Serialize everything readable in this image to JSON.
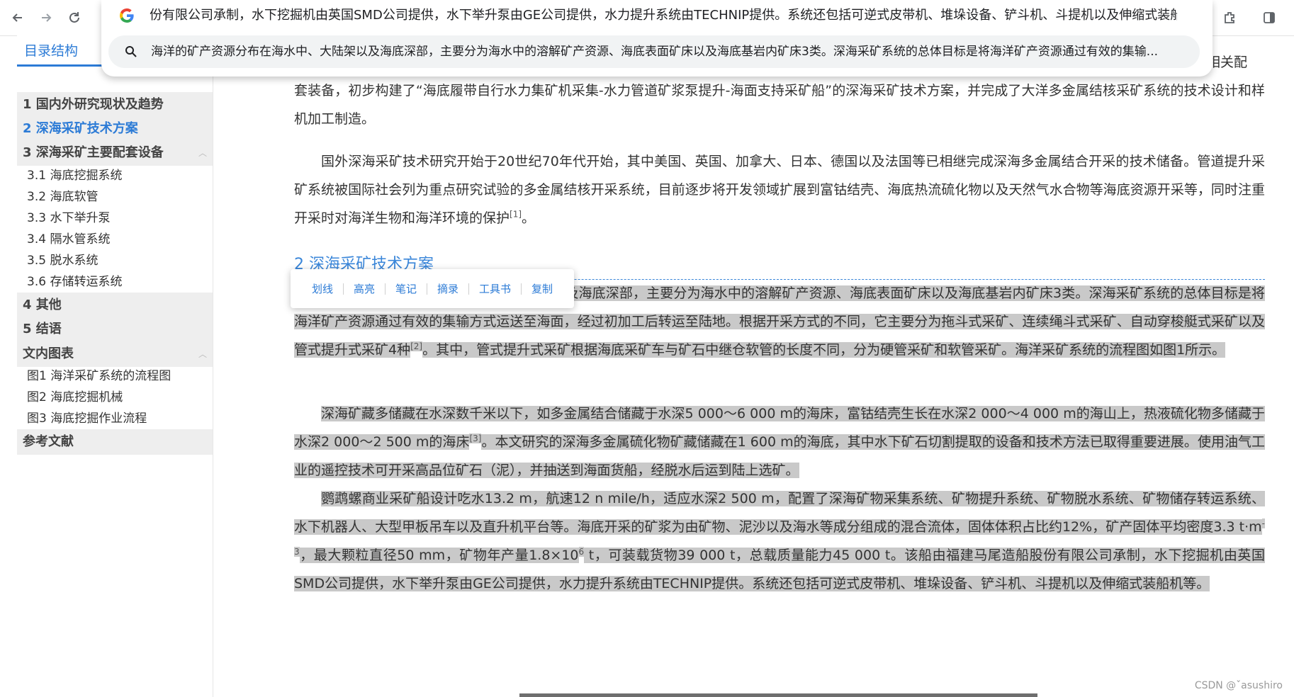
{
  "omnibox": {
    "text": "份有限公司承制，水下挖掘机由英国SMD公司提供，水下举升泵由GE公司提供，水力提升系统由TECHNIP提供。系统还包括可逆式皮带机、堆垛设备、铲斗机、斗提机以及伸缩式装船机等。",
    "suggestion": "海洋的矿产资源分布在海水中、大陆架以及海底深部，主要分为海水中的溶解矿产资源、海底表面矿床以及海底基岩内矿床3类。深海采矿系统的总体目标是将海洋矿产资源通过有效的集输..."
  },
  "sidebar": {
    "title": "目录结构",
    "sections": [
      {
        "label": "1 国内外研究现状及趋势"
      },
      {
        "label": "2 深海采矿技术方案"
      },
      {
        "label": "3 深海采矿主要配套设备"
      },
      {
        "label": "4 其他"
      },
      {
        "label": "5 结语"
      },
      {
        "label": "文内图表"
      },
      {
        "label": "参考文献"
      }
    ],
    "sub3": [
      "3.1 海底挖掘系统",
      "3.2 海底软管",
      "3.3 水下举升泵",
      "3.4 隔水管系统",
      "3.5 脱水系统",
      "3.6 存储转运系统"
    ],
    "figs": [
      "图1 海洋采矿系统的流程图",
      "图2 海底挖掘机械",
      "图3 海底挖掘作业流程"
    ]
  },
  "article": {
    "p0_tail": "X相关配",
    "p0": "套装备，初步构建了“海底履带自行水力集矿机采集-水力管道矿浆泵提升-海面支持采矿船”的深海采矿技术方案，并完成了大洋多金属结核采矿系统的技术设计和样机加工制造。",
    "p1": "国外深海采矿技术研究开始于20世纪70年代开始，其中美国、英国、加拿大、日本、德国以及法国等已相继完成深海多金属结合开采的技术储备。管道提升采矿系统被国际社会列为重点研究试验的多金属结核开采系统，目前逐步将开发领域扩展到富钴结壳、海底热流硫化物以及天然气水合物等海底资源开采等，同时注重开采时对海洋生物和海洋环境的保护",
    "p1_ref": "[1]",
    "p1_end": "。",
    "heading": "2 深海采矿技术方案",
    "p2a": "海洋的矿产资源分布在海水中、大陆架以及海底深部，主要分为海水中的溶解矿产资源、海底表面矿床以及海底基岩内矿床3类。深海采矿系统的总体目标是将海洋矿产资源通过有效的集输方式运送至海面，经过初加工后转运至陆地。根据开采方式的不同，它主要分为拖斗式采矿、连续绳斗式采矿、自动穿梭艇式采矿以及管式提升式采矿4种",
    "p2_ref": "[2]",
    "p2b": "。其中，管式提升式采矿根据海底采矿车与矿石中继仓软管的长度不同，分为硬管采矿和软管采矿。海洋采矿系统的流程图如图1所示。",
    "p3a": "深海矿藏多储藏在水深数千米以下，如多金属结合储藏于水深5 000～6 000 m的海床，富钴结壳生长在水深2 000～4 000 m的海山上，热液硫化物多储藏于水深2 000～2 500 m的海床",
    "p3_ref": "[3]",
    "p3b": "。本文研究的深海多金属硫化物矿藏储藏在1 600 m的海底，其中水下矿石切割提取的设备和技术方法已取得重要进展。使用油气工业的遥控技术可开采高品位矿石（泥），并抽送到海面货船，经脱水后运到陆上选矿。",
    "p4a": "鹦鹉螺商业采矿船设计吃水13.2 m，航速12 n mile/h，适应水深2 500 m，配置了深海矿物采集系统、矿物提升系统、矿物脱水系统、矿物储存转运系统、水下机器人、大型甲板吊车以及直升机平台等。海底开采的矿浆为由矿物、泥沙以及海水等成分组成的混合流体，固体体积占比约12%，矿产固体平均密度3.3 t·m",
    "p4_sup1": "-3",
    "p4b": "，最大颗粒直径50 mm，矿物年产量1.8×10",
    "p4_sup2": "6",
    "p4c": " t，可装载货物39 000 t，总载质量能力45 000 t。该船由福建马尾造船股份有限公司承制，水下挖掘机由英国SMD公司提供，水下举升泵由GE公司提供，水力提升系统由TECHNIP提供。系统还包括可逆式皮带机、堆垛设备、铲斗机、斗提机以及伸缩式装船机等。"
  },
  "popup": {
    "items": [
      "划线",
      "高亮",
      "笔记",
      "摘录",
      "工具书",
      "复制"
    ]
  },
  "watermark": "CSDN @ˇasushiro"
}
